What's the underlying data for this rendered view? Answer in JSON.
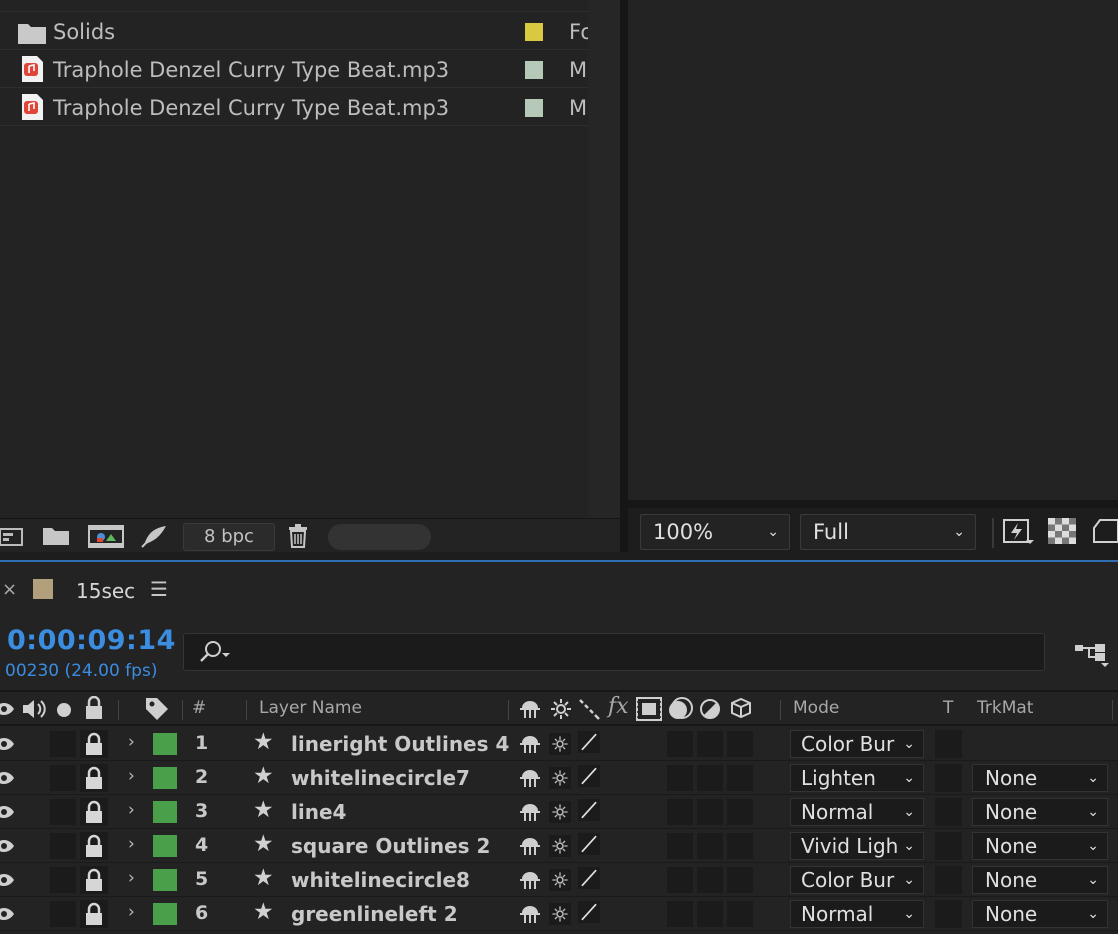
{
  "project": {
    "items": [
      {
        "name": "Solids",
        "kind": "folder",
        "swatch": "#d8c940",
        "type": "Fo"
      },
      {
        "name": "Traphole Denzel Curry Type Beat.mp3",
        "kind": "audio",
        "swatch": "#b6c8b8",
        "type": "M"
      },
      {
        "name": "Traphole Denzel Curry Type Beat.mp3",
        "kind": "audio",
        "swatch": "#b6c8b8",
        "type": "M"
      }
    ],
    "bpc_label": "8 bpc"
  },
  "viewer": {
    "zoom": "100%",
    "resolution": "Full"
  },
  "timeline": {
    "comp_name": "15sec",
    "comp_color": "#b2a07c",
    "timecode": "0:00:09:14",
    "frames": "00230 (24.00 fps)",
    "headers": {
      "number": "#",
      "layer_name": "Layer Name",
      "fx": "fx",
      "mode": "Mode",
      "t": "T",
      "trkmat": "TrkMat"
    },
    "layers": [
      {
        "num": "1",
        "name": "lineright Outlines 4",
        "mode": "Color Bur",
        "trkmat": ""
      },
      {
        "num": "2",
        "name": "whitelinecircle7",
        "mode": "Lighten",
        "trkmat": "None"
      },
      {
        "num": "3",
        "name": "line4",
        "mode": "Normal",
        "trkmat": "None"
      },
      {
        "num": "4",
        "name": "square Outlines 2",
        "mode": "Vivid Ligh",
        "trkmat": "None"
      },
      {
        "num": "5",
        "name": "whitelinecircle8",
        "mode": "Color Bur",
        "trkmat": "None"
      },
      {
        "num": "6",
        "name": "greenlineleft 2",
        "mode": "Normal",
        "trkmat": "None"
      }
    ],
    "label_color": "#4aa04a",
    "accent_color": "#3a8de0"
  }
}
